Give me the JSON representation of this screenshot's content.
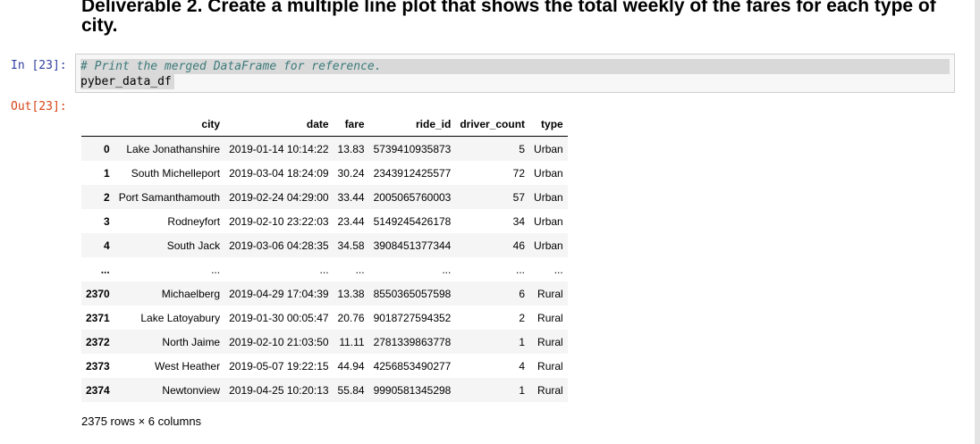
{
  "heading": "Deliverable 2. Create a multiple line plot that shows the total weekly of the fares for each type of city.",
  "cell": {
    "in_prompt": "In [23]:",
    "out_prompt": "Out[23]:",
    "code_line1": "# Print the merged DataFrame for reference.",
    "code_line2": "pyber_data_df"
  },
  "table": {
    "columns": [
      "",
      "city",
      "date",
      "fare",
      "ride_id",
      "driver_count",
      "type"
    ],
    "rows": [
      [
        "0",
        "Lake Jonathanshire",
        "2019-01-14 10:14:22",
        "13.83",
        "5739410935873",
        "5",
        "Urban"
      ],
      [
        "1",
        "South Michelleport",
        "2019-03-04 18:24:09",
        "30.24",
        "2343912425577",
        "72",
        "Urban"
      ],
      [
        "2",
        "Port Samanthamouth",
        "2019-02-24 04:29:00",
        "33.44",
        "2005065760003",
        "57",
        "Urban"
      ],
      [
        "3",
        "Rodneyfort",
        "2019-02-10 23:22:03",
        "23.44",
        "5149245426178",
        "34",
        "Urban"
      ],
      [
        "4",
        "South Jack",
        "2019-03-06 04:28:35",
        "34.58",
        "3908451377344",
        "46",
        "Urban"
      ],
      [
        "...",
        "...",
        "...",
        "...",
        "...",
        "...",
        "..."
      ],
      [
        "2370",
        "Michaelberg",
        "2019-04-29 17:04:39",
        "13.38",
        "8550365057598",
        "6",
        "Rural"
      ],
      [
        "2371",
        "Lake Latoyabury",
        "2019-01-30 00:05:47",
        "20.76",
        "9018727594352",
        "2",
        "Rural"
      ],
      [
        "2372",
        "North Jaime",
        "2019-02-10 21:03:50",
        "11.11",
        "2781339863778",
        "1",
        "Rural"
      ],
      [
        "2373",
        "West Heather",
        "2019-05-07 19:22:15",
        "44.94",
        "4256853490277",
        "4",
        "Rural"
      ],
      [
        "2374",
        "Newtonview",
        "2019-04-25 10:20:13",
        "55.84",
        "9990581345298",
        "1",
        "Rural"
      ]
    ],
    "summary": "2375 rows × 6 columns"
  }
}
